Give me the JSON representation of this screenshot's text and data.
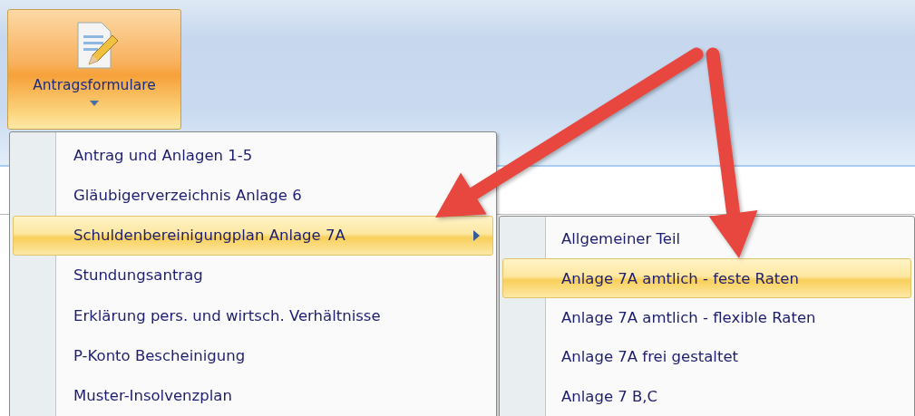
{
  "ribbon": {
    "button": {
      "label": "Antragsformulare",
      "selected": true
    }
  },
  "menu": {
    "items": [
      {
        "label": "Antrag und Anlagen 1-5",
        "selected": false,
        "has_submenu": false
      },
      {
        "label": "Gläubigerverzeichnis Anlage 6",
        "selected": false,
        "has_submenu": false
      },
      {
        "label": "Schuldenbereinigungplan Anlage 7A",
        "selected": true,
        "has_submenu": true
      },
      {
        "label": "Stundungsantrag",
        "selected": false,
        "has_submenu": false
      },
      {
        "label": "Erklärung pers. und wirtsch. Verhältnisse",
        "selected": false,
        "has_submenu": false
      },
      {
        "label": "P-Konto Bescheinigung",
        "selected": false,
        "has_submenu": false
      },
      {
        "label": "Muster-Insolvenzplan",
        "selected": false,
        "has_submenu": false
      }
    ]
  },
  "submenu": {
    "items": [
      {
        "label": "Allgemeiner Teil",
        "selected": false
      },
      {
        "label": "Anlage 7A amtlich - feste Raten",
        "selected": true
      },
      {
        "label": "Anlage 7A amtlich - flexible Raten",
        "selected": false
      },
      {
        "label": "Anlage 7A frei gestaltet",
        "selected": false
      },
      {
        "label": "Anlage 7 B,C",
        "selected": false
      }
    ]
  },
  "annotations": [
    {
      "kind": "arrow"
    },
    {
      "kind": "arrow"
    }
  ]
}
